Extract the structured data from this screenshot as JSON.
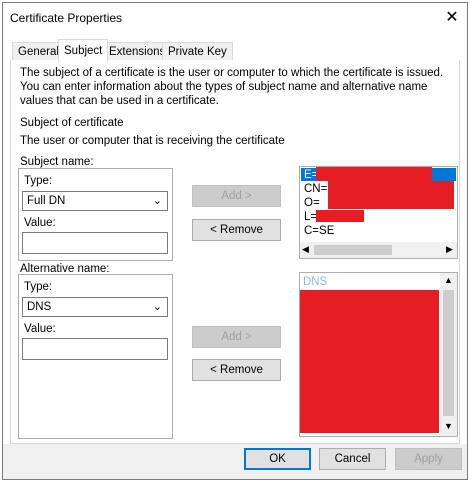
{
  "window": {
    "title": "Certificate Properties",
    "close_glyph": "✕"
  },
  "tabs": [
    {
      "label": "General"
    },
    {
      "label": "Subject"
    },
    {
      "label": "Extensions"
    },
    {
      "label": "Private Key"
    }
  ],
  "intro_text": "The subject of a certificate is the user or computer to which the certificate is issued. You can enter information about the types of subject name and alternative name values that can be used in a certificate.",
  "subject_heading": "Subject of certificate",
  "subject_desc": "The user or computer that is receiving the certificate",
  "subject_name": {
    "label": "Subject name:",
    "type_label": "Type:",
    "type_value": "Full DN",
    "value_label": "Value:",
    "value": "",
    "add_label": "Add >",
    "remove_label": "< Remove",
    "entries": [
      "E=",
      "CN=",
      "O=",
      "L=",
      "C=SE"
    ]
  },
  "alt_name": {
    "label": "Alternative name:",
    "type_label": "Type:",
    "type_value": "DNS",
    "value_label": "Value:",
    "value": "",
    "add_label": "Add >",
    "remove_label": "< Remove",
    "entries_header": "DNS"
  },
  "footer": {
    "ok_label": "OK",
    "cancel_label": "Cancel",
    "apply_label": "Apply"
  },
  "colors": {
    "accent": "#0078d7",
    "redaction": "#e51e25"
  },
  "icons": {
    "chevron": "chevron-down-icon",
    "scroll_up": "▲",
    "scroll_down": "▼",
    "scroll_left": "◀",
    "scroll_right": "▶",
    "chevron_glyph": "⌄"
  }
}
